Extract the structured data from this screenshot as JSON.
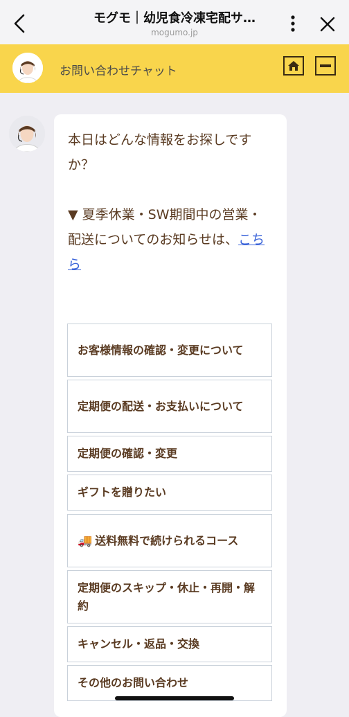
{
  "browser": {
    "title": "モグモ｜幼児食冷凍宅配サ…",
    "url": "mogumo.jp",
    "icons": {
      "back": "chevron-left-icon",
      "more": "more-vertical-icon",
      "close": "close-icon"
    }
  },
  "chat_header": {
    "title": "お問い合わせチャット",
    "icons": {
      "home": "home-icon",
      "minimize": "minimize-icon"
    },
    "accent_color": "#f9d54c"
  },
  "message": {
    "line1": "本日はどんな情報をお探しですか？",
    "notice_prefix": "▼ 夏季休業・SW期間中の営業・配送についてのお知らせは、",
    "notice_link": "こちら"
  },
  "options": [
    {
      "label": "お客様情報の確認・変更について"
    },
    {
      "label": "定期便の配送・お支払いについて"
    },
    {
      "label": "定期便の確認・変更"
    },
    {
      "label": "ギフトを贈りたい"
    },
    {
      "emoji": "🚚",
      "label": "送料無料で続けられるコース"
    },
    {
      "label": "定期便のスキップ・休止・再開・解約"
    },
    {
      "label": "キャンセル・返品・交換"
    },
    {
      "label": "その他のお問い合わせ"
    }
  ]
}
